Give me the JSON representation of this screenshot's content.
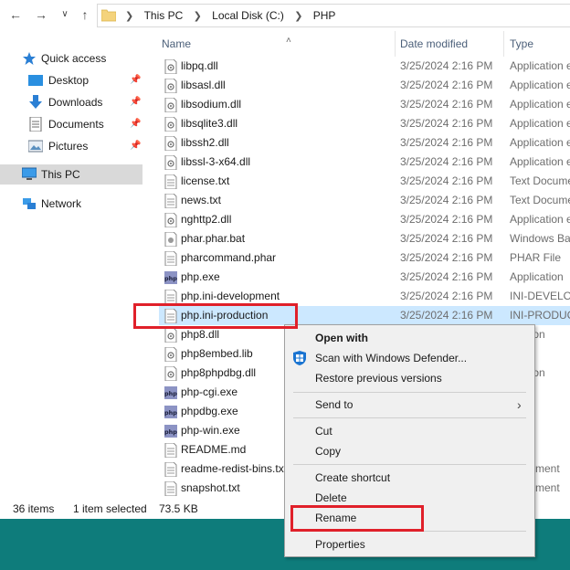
{
  "breadcrumb": [
    "This PC",
    "Local Disk (C:)",
    "PHP"
  ],
  "nav": {
    "quick_access": "Quick access",
    "desktop": "Desktop",
    "downloads": "Downloads",
    "documents": "Documents",
    "pictures": "Pictures",
    "this_pc": "This PC",
    "network": "Network"
  },
  "columns": {
    "name": "Name",
    "date": "Date modified",
    "type": "Type"
  },
  "files": [
    {
      "name": "libpq.dll",
      "date": "3/25/2024 2:16 PM",
      "type": "Application extension"
    },
    {
      "name": "libsasl.dll",
      "date": "3/25/2024 2:16 PM",
      "type": "Application extension"
    },
    {
      "name": "libsodium.dll",
      "date": "3/25/2024 2:16 PM",
      "type": "Application extension"
    },
    {
      "name": "libsqlite3.dll",
      "date": "3/25/2024 2:16 PM",
      "type": "Application extension"
    },
    {
      "name": "libssh2.dll",
      "date": "3/25/2024 2:16 PM",
      "type": "Application extension"
    },
    {
      "name": "libssl-3-x64.dll",
      "date": "3/25/2024 2:16 PM",
      "type": "Application extension"
    },
    {
      "name": "license.txt",
      "date": "3/25/2024 2:16 PM",
      "type": "Text Document"
    },
    {
      "name": "news.txt",
      "date": "3/25/2024 2:16 PM",
      "type": "Text Document"
    },
    {
      "name": "nghttp2.dll",
      "date": "3/25/2024 2:16 PM",
      "type": "Application extension"
    },
    {
      "name": "phar.phar.bat",
      "date": "3/25/2024 2:16 PM",
      "type": "Windows Batch File"
    },
    {
      "name": "pharcommand.phar",
      "date": "3/25/2024 2:16 PM",
      "type": "PHAR File"
    },
    {
      "name": "php.exe",
      "date": "3/25/2024 2:16 PM",
      "type": "Application"
    },
    {
      "name": "php.ini-development",
      "date": "3/25/2024 2:16 PM",
      "type": "INI-DEVELOPMENT File"
    },
    {
      "name": "php.ini-production",
      "date": "3/25/2024 2:16 PM",
      "type": "INI-PRODUCTION File"
    },
    {
      "name": "php8.dll",
      "date": "",
      "type": "tension"
    },
    {
      "name": "php8embed.lib",
      "date": "",
      "type": "ile"
    },
    {
      "name": "php8phpdbg.dll",
      "date": "",
      "type": "tension"
    },
    {
      "name": "php-cgi.exe",
      "date": "",
      "type": "tion"
    },
    {
      "name": "phpdbg.exe",
      "date": "",
      "type": "tion"
    },
    {
      "name": "php-win.exe",
      "date": "",
      "type": "tion"
    },
    {
      "name": "README.md",
      "date": "",
      "type": "ile"
    },
    {
      "name": "readme-redist-bins.txt",
      "date": "",
      "type": "Document"
    },
    {
      "name": "snapshot.txt",
      "date": "",
      "type": "Document"
    }
  ],
  "status": {
    "count": "36 items",
    "selected": "1 item selected",
    "size": "73.5 KB"
  },
  "context_menu": {
    "open_with": "Open with",
    "scan": "Scan with Windows Defender...",
    "restore": "Restore previous versions",
    "send_to": "Send to",
    "cut": "Cut",
    "copy": "Copy",
    "create_shortcut": "Create shortcut",
    "delete": "Delete",
    "rename": "Rename",
    "properties": "Properties"
  },
  "colors": {
    "selection": "#cce8ff",
    "highlight": "#e0202a",
    "desktop": "#0e7c7b"
  }
}
